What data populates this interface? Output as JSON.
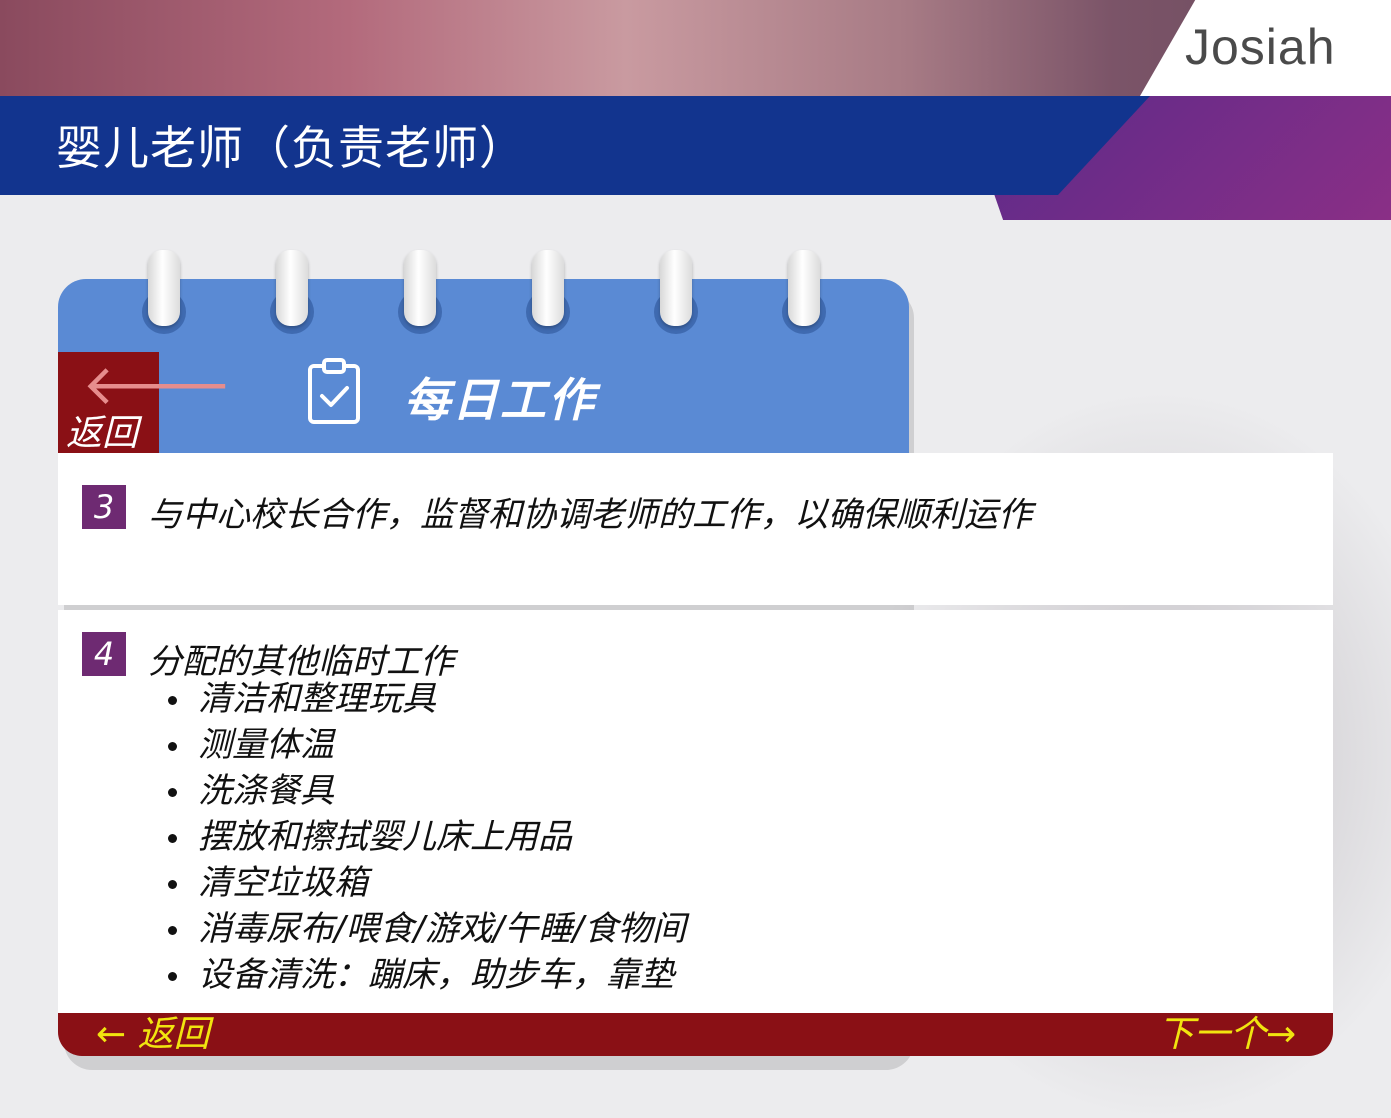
{
  "header": {
    "title": "婴儿老师（负责老师）",
    "logo_text": "Josiah",
    "colors": {
      "title_bar": "#12348e",
      "accent_bar": "#7a2d88"
    }
  },
  "card": {
    "title": "每日工作",
    "back_label": "返回",
    "back_icon": "left-arrow-icon",
    "title_icon": "clipboard-check-icon",
    "colors": {
      "header": "#5a8ad4",
      "back_box": "#8a1015"
    }
  },
  "items": [
    {
      "number": "3",
      "text": "与中心校长合作，监督和协调老师的工作，以确保顺利运作"
    },
    {
      "number": "4",
      "text": "分配的其他临时工作",
      "subitems": [
        "清洁和整理玩具",
        "测量体温",
        "洗涤餐具",
        "摆放和擦拭婴儿床上用品",
        "清空垃圾箱",
        "消毒尿布/喂食/游戏/午睡/食物间",
        "设备清洗：蹦床，助步车，靠垫"
      ]
    }
  ],
  "footer": {
    "back_label": "← 返回",
    "next_label": "下一个→",
    "colors": {
      "bar": "#8a1015",
      "text": "#f1e40f"
    }
  }
}
